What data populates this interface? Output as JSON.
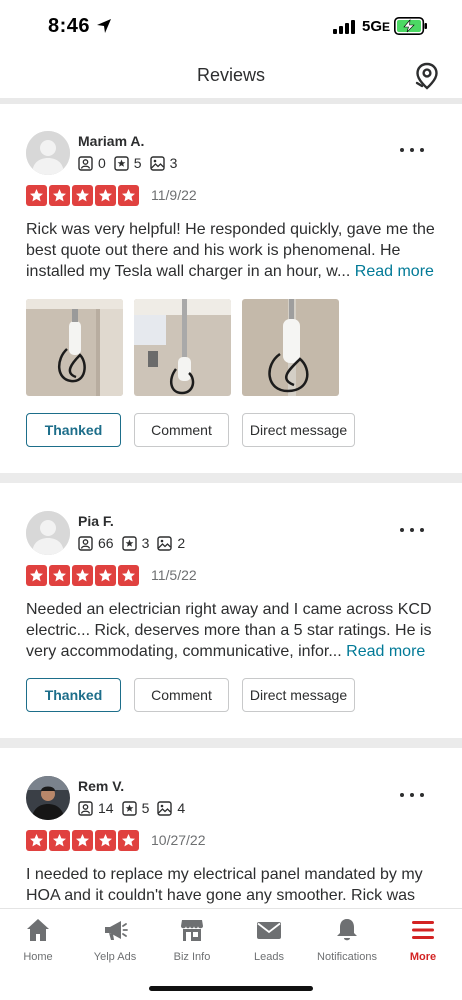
{
  "status_bar": {
    "time": "8:46",
    "network": "5G",
    "network_suffix": "E"
  },
  "header": {
    "title": "Reviews"
  },
  "reviews": [
    {
      "name": "Mariam A.",
      "friends": "0",
      "reviews_count": "5",
      "photos_count": "3",
      "rating": 5,
      "date": "11/9/22",
      "text": "Rick was very helpful! He responded quickly, gave me the best quote out there and his work is phenomenal. He installed my Tesla wall charger in an hour, w...",
      "read_more": "Read more",
      "photos": [
        "wall-charger-photo",
        "wall-charger-photo",
        "wall-charger-photo"
      ],
      "thanked_label": "Thanked",
      "comment_label": "Comment",
      "dm_label": "Direct message"
    },
    {
      "name": "Pia F.",
      "friends": "66",
      "reviews_count": "3",
      "photos_count": "2",
      "rating": 5,
      "date": "11/5/22",
      "text": "Needed an electrician right away and I came across KCD electric... Rick, deserves more than a 5 star ratings. He is very accommodating, communicative, infor...",
      "read_more": "Read more",
      "thanked_label": "Thanked",
      "comment_label": "Comment",
      "dm_label": "Direct message"
    },
    {
      "name": "Rem V.",
      "friends": "14",
      "reviews_count": "5",
      "photos_count": "4",
      "rating": 5,
      "date": "10/27/22",
      "text": "I needed to replace my electrical panel mandated by my HOA and it couldn't have gone any smoother. Rick was"
    }
  ],
  "tabs": [
    {
      "label": "Home",
      "icon": "home-icon"
    },
    {
      "label": "Yelp Ads",
      "icon": "megaphone-icon"
    },
    {
      "label": "Biz Info",
      "icon": "storefront-icon"
    },
    {
      "label": "Leads",
      "icon": "envelope-icon"
    },
    {
      "label": "Notifications",
      "icon": "bell-icon"
    },
    {
      "label": "More",
      "icon": "hamburger-icon",
      "active": true
    }
  ],
  "colors": {
    "star_red": "#e0413f",
    "link_teal": "#027a97",
    "thanked_blue": "#1d6e8a",
    "active_red": "#d32323"
  }
}
